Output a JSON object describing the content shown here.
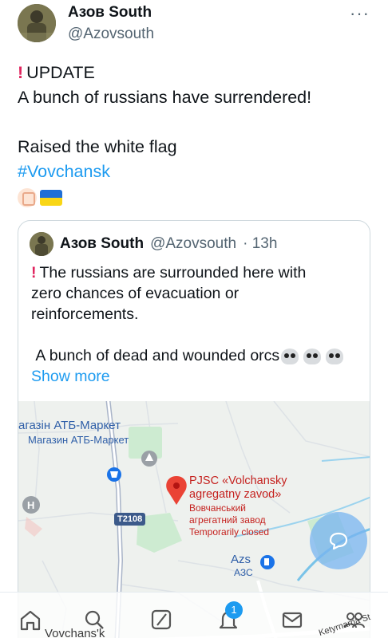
{
  "author": {
    "name": "Азов South",
    "handle": "@Azovsouth",
    "more_icon": "more-horizontal-icon"
  },
  "tweet": {
    "lines": [
      "UPDATE",
      "A bunch of russians have surrendered!",
      "",
      "Raised the white flag"
    ],
    "hashtag": "#Vovchansk",
    "emojis": [
      "raised-fist-emoji",
      "ukraine-flag-emoji"
    ]
  },
  "quote": {
    "name": "Азов South",
    "handle": "@Azovsouth",
    "time": "· 13h",
    "lines": [
      "The russians are surrounded here with",
      "zero chances of evacuation or",
      "reinforcements.",
      "",
      "A bunch of dead and wounded orcs"
    ],
    "show_more": "Show more"
  },
  "map": {
    "store_label_1": "агазін АТБ-Маркет",
    "store_label_2": "Магазин АТБ-Маркет",
    "road_badge": "T2108",
    "poi_title_1": "PJSC «Volchansky",
    "poi_title_2": "agregatny zavod»",
    "poi_sub_1": "Вовчанський",
    "poi_sub_2": "агрегатний завод",
    "poi_status": "Temporarily closed",
    "azs": "Azs",
    "azs_sub": "АЗС",
    "bottom_left": "Vovchans'k",
    "bottom_right": "Ketyrnarna St"
  },
  "tabbar": {
    "items": [
      "home-icon",
      "search-icon",
      "grok-icon",
      "notifications-icon",
      "messages-icon",
      "communities-icon"
    ],
    "notification_count": "1"
  },
  "colors": {
    "accent": "#1d9bf0",
    "text": "#0f1419",
    "secondary": "#536471",
    "alert": "#e0245e"
  }
}
